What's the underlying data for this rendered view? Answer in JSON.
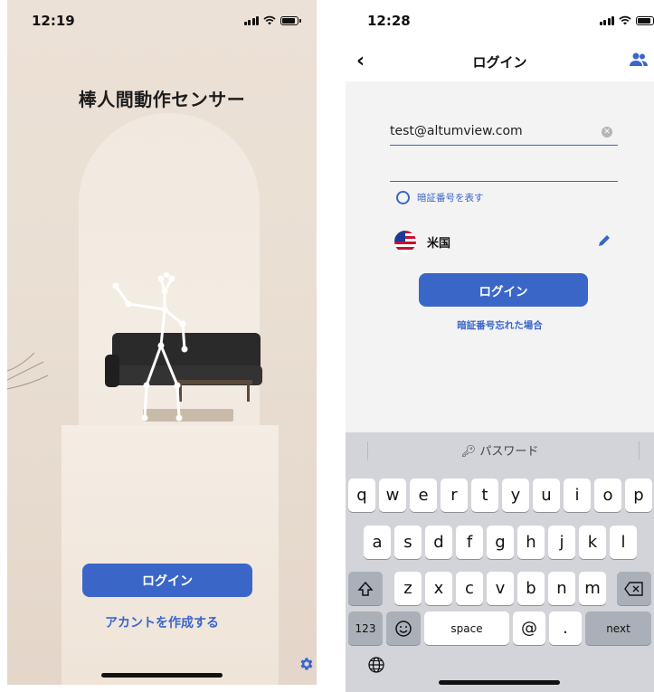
{
  "left_screen": {
    "status_time": "12:19",
    "app_title": "棒人間動作センサー",
    "login_button": "ログイン",
    "create_account_link": "アカントを作成する",
    "settings_icon": "gear-icon"
  },
  "right_screen": {
    "status_time": "12:28",
    "nav": {
      "back_icon": "chevron-left-icon",
      "title": "ログイン",
      "users_icon": "users-icon"
    },
    "email_value": "test@altumview.com",
    "password_value": "",
    "show_password_label": "暗証番号を表す",
    "country_name": "米国",
    "login_button": "ログイン",
    "forgot_link": "暗証番号忘れた場合",
    "keyboard": {
      "suggestion": "パスワード",
      "row1": [
        "q",
        "w",
        "e",
        "r",
        "t",
        "y",
        "u",
        "i",
        "o",
        "p"
      ],
      "row2": [
        "a",
        "s",
        "d",
        "f",
        "g",
        "h",
        "j",
        "k",
        "l"
      ],
      "row3": [
        "z",
        "x",
        "c",
        "v",
        "b",
        "n",
        "m"
      ],
      "numbers_key": "123",
      "space_key": "space",
      "at_key": "@",
      "period_key": ".",
      "next_key": "next"
    }
  },
  "colors": {
    "accent": "#3a66c8",
    "keyboard_bg": "#d2d4d9"
  }
}
